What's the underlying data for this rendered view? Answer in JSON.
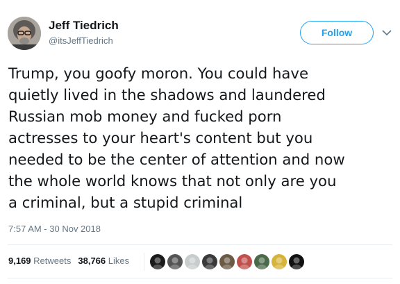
{
  "user": {
    "display_name": "Jeff Tiedrich",
    "handle": "@itsJeffTiedrich",
    "avatar_icon": "profile-photo"
  },
  "follow_label": "Follow",
  "menu_icon": "chevron-down-icon",
  "tweet": {
    "text": "Trump, you goofy moron. You could have\nquietly lived in the shadows and laundered\nRussian mob money and fucked porn\nactresses to your heart's content but you\nneeded to be the center of attention and now\nthe whole world knows that not only are you\na criminal, but a stupid criminal",
    "timestamp": "7:57 AM - 30 Nov 2018"
  },
  "stats": {
    "retweets_count": "9,169",
    "retweets_label": "Retweets",
    "likes_count": "38,766",
    "likes_label": "Likes"
  },
  "liked_by_avatars": [
    {
      "name": "liker-avatar-1",
      "color": "#1a1a1a"
    },
    {
      "name": "liker-avatar-2",
      "color": "#555555"
    },
    {
      "name": "liker-avatar-3",
      "color": "#c9cccc"
    },
    {
      "name": "liker-avatar-4",
      "color": "#3a3a3a"
    },
    {
      "name": "liker-avatar-5",
      "color": "#6b5a45"
    },
    {
      "name": "liker-avatar-6",
      "color": "#c0504d"
    },
    {
      "name": "liker-avatar-7",
      "color": "#4a6a4a"
    },
    {
      "name": "liker-avatar-8",
      "color": "#d6b33a"
    },
    {
      "name": "liker-avatar-9",
      "color": "#111111"
    }
  ],
  "colors": {
    "accent": "#1da1f2",
    "secondary_text": "#657786",
    "primary_text": "#14171a",
    "divider": "#e6ecf0"
  }
}
